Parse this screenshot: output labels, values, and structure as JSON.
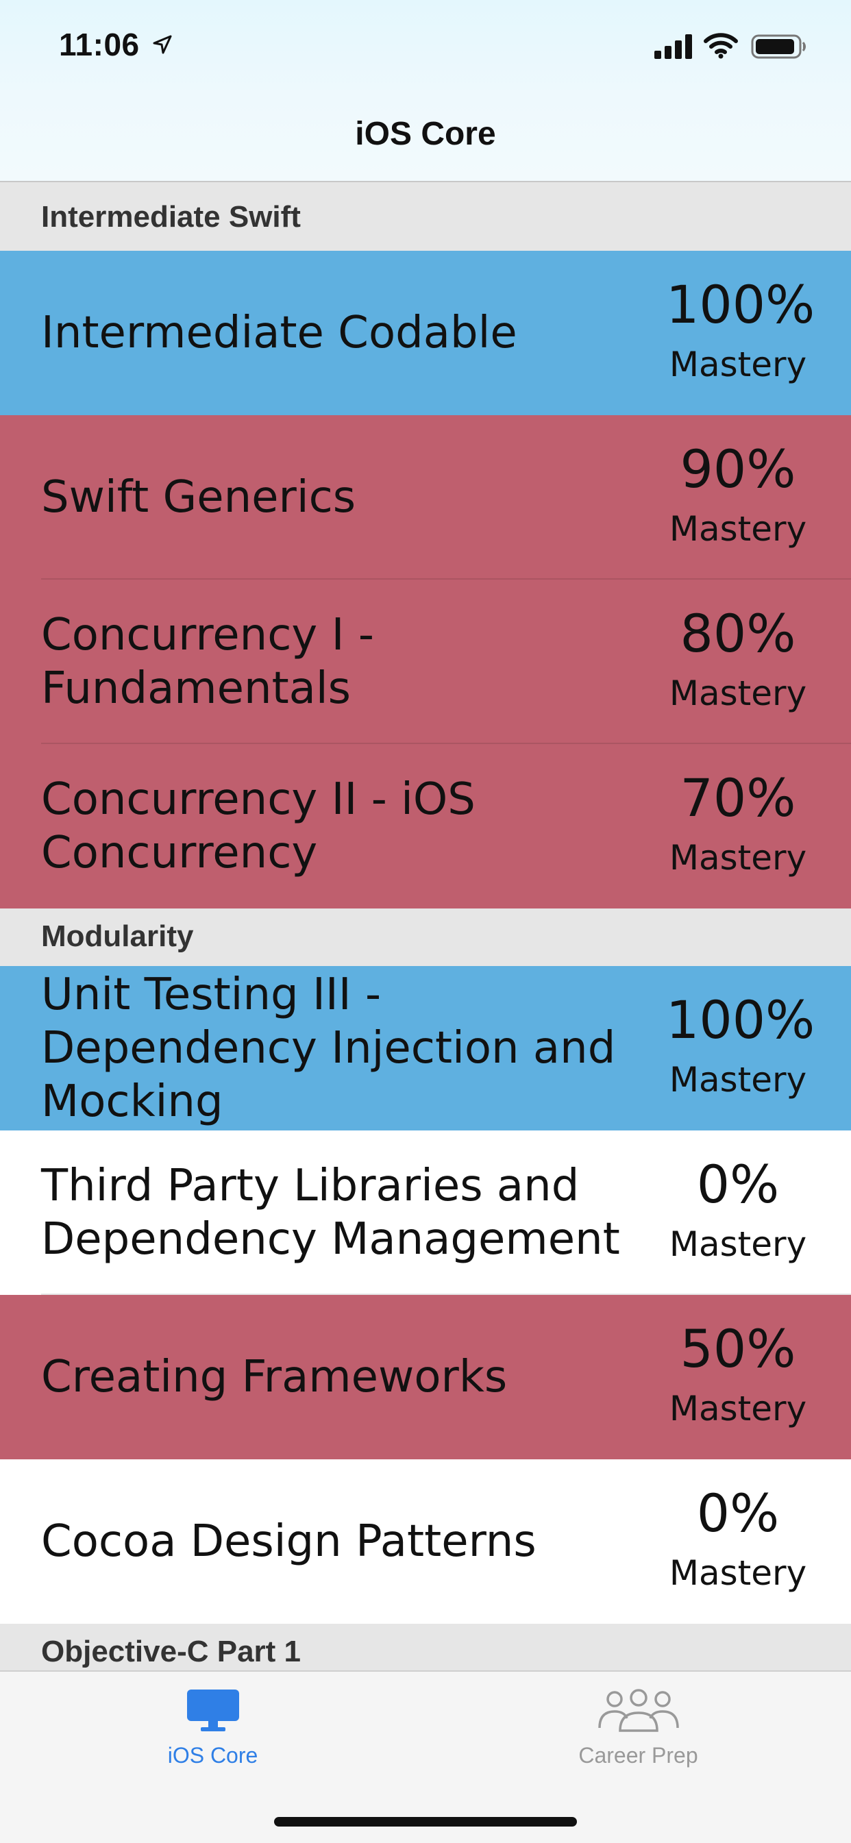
{
  "status_bar": {
    "time": "11:06"
  },
  "nav": {
    "title": "iOS Core"
  },
  "sections": [
    {
      "header": "Intermediate Swift",
      "rows": [
        {
          "title": "Intermediate Codable",
          "score": "100%",
          "mastery": "Mastery",
          "color": "#5fb0e0"
        },
        {
          "title": "Swift Generics",
          "score": "90%",
          "mastery": "Mastery",
          "color": "#bf5f6e"
        },
        {
          "title": "Concurrency I - Fundamentals",
          "score": "80%",
          "mastery": "Mastery",
          "color": "#bf5f6e"
        },
        {
          "title": "Concurrency II - iOS Concurrency",
          "score": "70%",
          "mastery": "Mastery",
          "color": "#bf5f6e"
        }
      ]
    },
    {
      "header": "Modularity",
      "rows": [
        {
          "title": "Unit Testing III - Dependency Injection and Mocking",
          "score": "100%",
          "mastery": "Mastery",
          "color": "#5fb0e0"
        },
        {
          "title": "Third Party Libraries and Dependency Management",
          "score": "0%",
          "mastery": "Mastery",
          "color": "#ffffff"
        },
        {
          "title": "Creating Frameworks",
          "score": "50%",
          "mastery": "Mastery",
          "color": "#bf5f6e"
        },
        {
          "title": "Cocoa Design Patterns",
          "score": "0%",
          "mastery": "Mastery",
          "color": "#ffffff"
        }
      ]
    },
    {
      "header": "Objective-C Part 1",
      "rows": []
    }
  ],
  "tabs": [
    {
      "label": "iOS Core",
      "icon": "monitor-icon",
      "active": true
    },
    {
      "label": "Career Prep",
      "icon": "people-icon",
      "active": false
    }
  ],
  "colors": {
    "mastered": "#5fb0e0",
    "in_progress": "#bf5f6e",
    "not_started": "#ffffff",
    "tab_active": "#2f7fe6",
    "tab_inactive": "#999999"
  }
}
